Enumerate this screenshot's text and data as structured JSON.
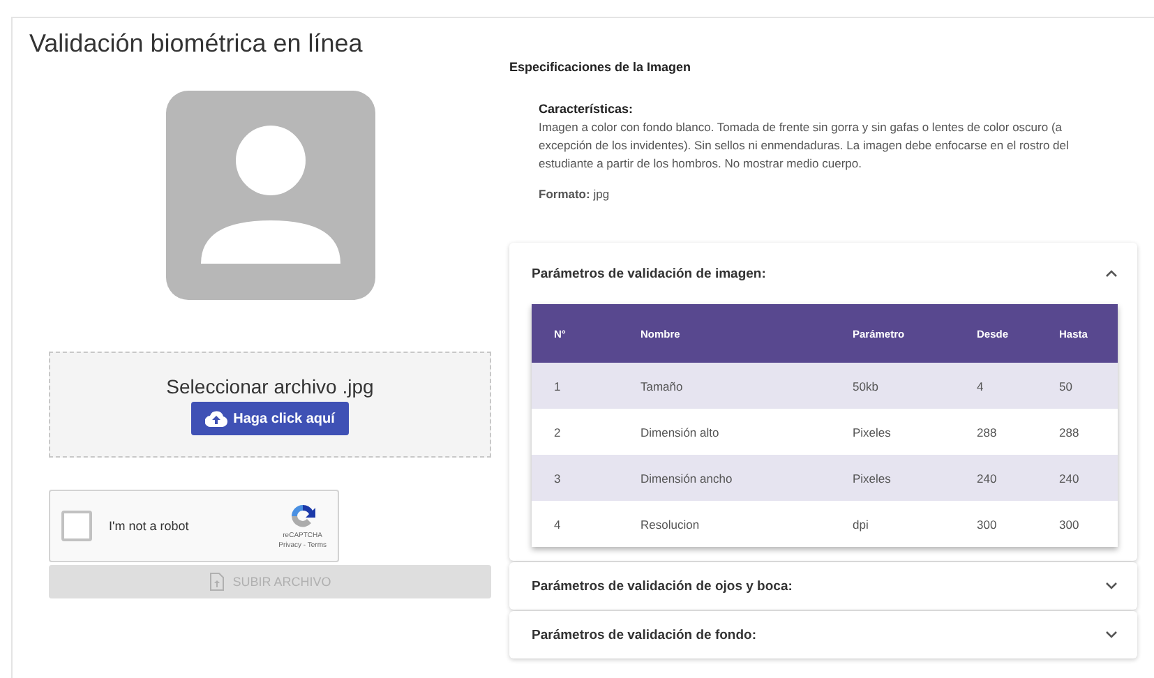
{
  "title": "Validación biométrica en línea",
  "upload": {
    "prompt": "Seleccionar archivo .jpg",
    "button": "Haga click aquí"
  },
  "captcha": {
    "label": "I'm not a robot",
    "checked": false,
    "brand": "reCAPTCHA",
    "links": "Privacy - Terms"
  },
  "submit": {
    "label": "SUBIR ARCHIVO",
    "disabled": true
  },
  "specs": {
    "heading": "Especificaciones de la Imagen",
    "features_label": "Características:",
    "features_text": "Imagen a color con fondo blanco. Tomada de frente sin gorra y sin gafas o lentes de color oscuro (a excepción de los invidentes). Sin sellos ni enmendaduras. La imagen debe enfocarse en el rostro del estudiante a partir de los hombros. No mostrar medio cuerpo.",
    "format_label": "Formato:",
    "format_value": "jpg"
  },
  "accordions": [
    {
      "title": "Parámetros de validación de imagen:",
      "expanded": true,
      "table": {
        "columns": [
          "N°",
          "Nombre",
          "Parámetro",
          "Desde",
          "Hasta"
        ],
        "rows": [
          [
            "1",
            "Tamaño",
            "50kb",
            "4",
            "50"
          ],
          [
            "2",
            "Dimensión alto",
            "Pixeles",
            "288",
            "288"
          ],
          [
            "3",
            "Dimensión ancho",
            "Pixeles",
            "240",
            "240"
          ],
          [
            "4",
            "Resolucion",
            "dpi",
            "300",
            "300"
          ]
        ]
      }
    },
    {
      "title": "Parámetros de validación de ojos y boca:",
      "expanded": false
    },
    {
      "title": "Parámetros de validación de fondo:",
      "expanded": false
    }
  ]
}
